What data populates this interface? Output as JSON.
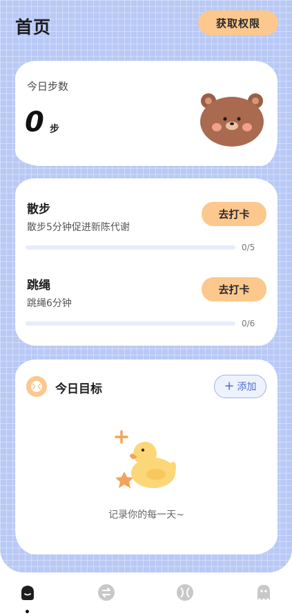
{
  "header": {
    "title": "首页",
    "permission_button": "获取权限"
  },
  "steps": {
    "label": "今日步数",
    "value": "0",
    "unit": "步"
  },
  "tasks": [
    {
      "title": "散步",
      "description": "散步5分钟促进新陈代谢",
      "button": "去打卡",
      "progress": 0,
      "count": "0/5"
    },
    {
      "title": "跳绳",
      "description": "跳绳6分钟",
      "button": "去打卡",
      "progress": 0,
      "count": "0/6"
    }
  ],
  "goal": {
    "title": "今日目标",
    "add_button": "添加",
    "empty_text": "记录你的每一天~"
  },
  "tabbar": {
    "icons": [
      "home-icon",
      "exchange-icon",
      "ball-icon",
      "ghost-icon"
    ],
    "active_index": 0
  },
  "colors": {
    "background": "#b9c9f6",
    "accent": "#fcc88e",
    "progress_track": "#e6ecfb",
    "add_button_text": "#4f6fc8"
  }
}
